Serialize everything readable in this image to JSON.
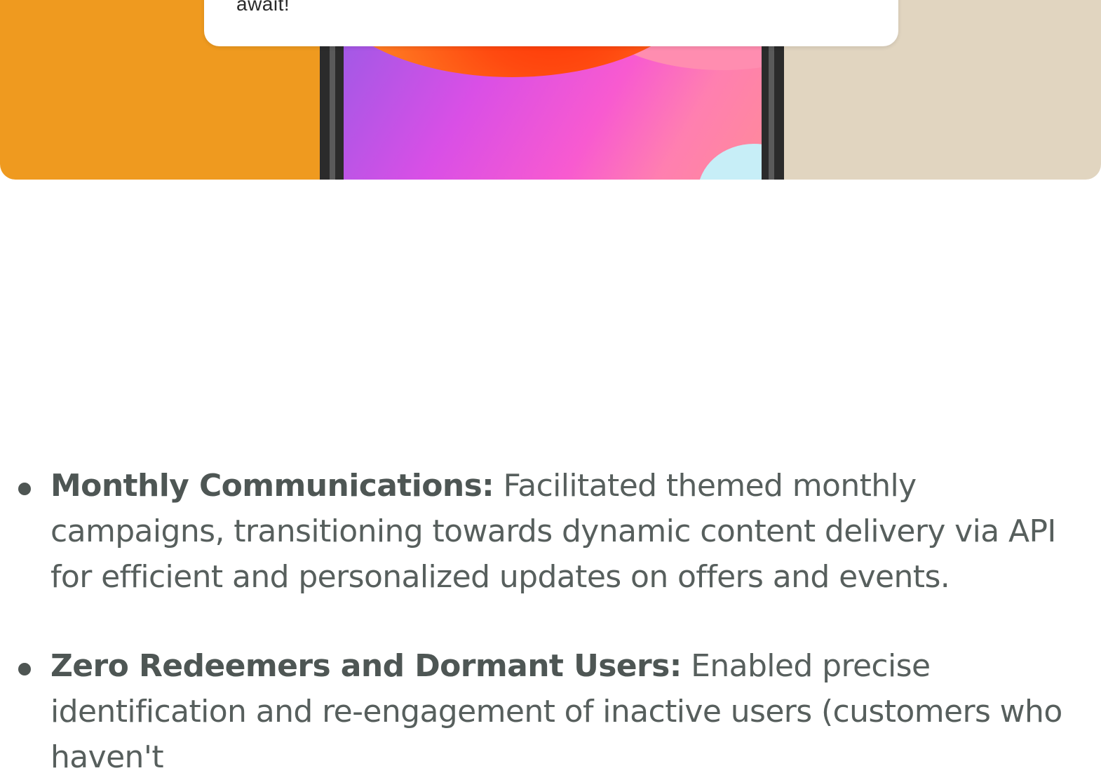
{
  "hero": {
    "notification_text": "await!",
    "colors": {
      "left_background": "#ef9a1f",
      "right_background": "#e1d5c0",
      "phone_frame": "#2b2b2b",
      "card": "#ffffff"
    }
  },
  "features": [
    {
      "title": "Monthly Communications:",
      "text": " Facilitated themed monthly campaigns, transitioning towards dynamic content delivery via API for efficient and personalized updates on offers and events."
    },
    {
      "title": "Zero Redeemers and Dormant Users:",
      "text": " Enabled precise identification and re-engagement of inactive users (customers who haven't"
    }
  ]
}
